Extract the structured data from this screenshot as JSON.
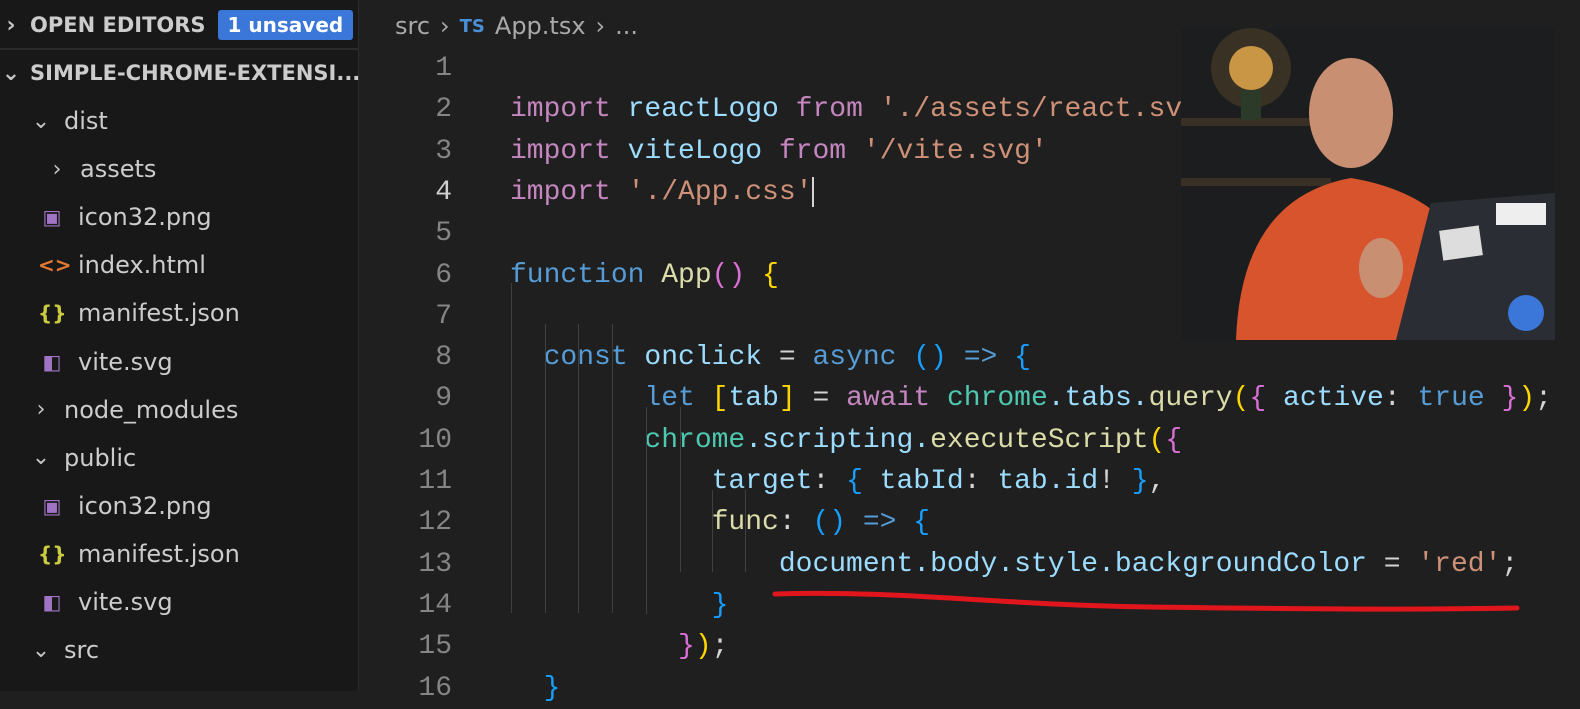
{
  "sidebar": {
    "open_editors": "OPEN EDITORS",
    "unsaved_badge": "1 unsaved",
    "project": "SIMPLE-CHROME-EXTENSI...",
    "items": [
      {
        "label": "dist",
        "icon": "chevron-down",
        "depth": 1
      },
      {
        "label": "assets",
        "icon": "chevron-right",
        "depth": 2
      },
      {
        "label": "icon32.png",
        "icon": "image",
        "depth": 2
      },
      {
        "label": "index.html",
        "icon": "html",
        "depth": 2
      },
      {
        "label": "manifest.json",
        "icon": "json",
        "depth": 2
      },
      {
        "label": "vite.svg",
        "icon": "svg",
        "depth": 2
      },
      {
        "label": "node_modules",
        "icon": "chevron-right",
        "depth": 1
      },
      {
        "label": "public",
        "icon": "chevron-down",
        "depth": 1
      },
      {
        "label": "icon32.png",
        "icon": "image",
        "depth": 2
      },
      {
        "label": "manifest.json",
        "icon": "json",
        "depth": 2
      },
      {
        "label": "vite.svg",
        "icon": "svg",
        "depth": 2
      },
      {
        "label": "src",
        "icon": "chevron-down",
        "depth": 1
      }
    ]
  },
  "breadcrumb": {
    "folder": "src",
    "lang": "TS",
    "file": "App.tsx",
    "more": "..."
  },
  "editor": {
    "current_line": 4,
    "lines": [
      {
        "n": "1",
        "tokens": []
      },
      {
        "n": "2",
        "tokens": [
          [
            "import",
            "kw"
          ],
          [
            " reactLogo ",
            "id"
          ],
          [
            "from",
            "kw"
          ],
          [
            " './assets/react.svg'",
            "st"
          ]
        ]
      },
      {
        "n": "3",
        "tokens": [
          [
            "import",
            "kw"
          ],
          [
            " viteLogo ",
            "id"
          ],
          [
            "from",
            "kw"
          ],
          [
            " '/vite.svg'",
            "st"
          ]
        ]
      },
      {
        "n": "4",
        "tokens": [
          [
            "import",
            "kw"
          ],
          [
            " './App.css'",
            "st"
          ]
        ],
        "cursor": true
      },
      {
        "n": "5",
        "tokens": []
      },
      {
        "n": "6",
        "tokens": [
          [
            "function",
            "bl"
          ],
          [
            " App",
            "fn"
          ],
          [
            "()",
            "b2"
          ],
          [
            " ",
            "pn"
          ],
          [
            "{",
            "b1"
          ]
        ]
      },
      {
        "n": "7",
        "tokens": []
      },
      {
        "n": "8",
        "tokens": [
          [
            "  const",
            "bl"
          ],
          [
            " onclick ",
            "id"
          ],
          [
            "= ",
            "pn"
          ],
          [
            "async",
            "bl"
          ],
          [
            " ",
            "pn"
          ],
          [
            "()",
            "b3"
          ],
          [
            " ",
            "pn"
          ],
          [
            "=>",
            "bl"
          ],
          [
            " ",
            "pn"
          ],
          [
            "{",
            "b3"
          ]
        ]
      },
      {
        "n": "9",
        "tokens": [
          [
            "        let",
            "bl"
          ],
          [
            " ",
            "pn"
          ],
          [
            "[",
            "b1"
          ],
          [
            "tab",
            "id"
          ],
          [
            "]",
            "b1"
          ],
          [
            " = ",
            "pn"
          ],
          [
            "await",
            "kw"
          ],
          [
            " chrome",
            "cl"
          ],
          [
            ".tabs.",
            "id"
          ],
          [
            "query",
            "fn"
          ],
          [
            "(",
            "b1"
          ],
          [
            "{",
            "b2"
          ],
          [
            " active",
            "id"
          ],
          [
            ": ",
            "pn"
          ],
          [
            "true",
            "bl"
          ],
          [
            " ",
            "pn"
          ],
          [
            "}",
            "b2"
          ],
          [
            ")",
            "b1"
          ],
          [
            ";",
            "pn"
          ]
        ]
      },
      {
        "n": "10",
        "tokens": [
          [
            "        chrome",
            "cl"
          ],
          [
            ".scripting.",
            "id"
          ],
          [
            "executeScript",
            "fn"
          ],
          [
            "(",
            "b1"
          ],
          [
            "{",
            "b2"
          ]
        ]
      },
      {
        "n": "11",
        "tokens": [
          [
            "            target",
            "id"
          ],
          [
            ": ",
            "pn"
          ],
          [
            "{",
            "b3"
          ],
          [
            " tabId",
            "id"
          ],
          [
            ": ",
            "pn"
          ],
          [
            "tab.id",
            "id"
          ],
          [
            "! ",
            "pn"
          ],
          [
            "}",
            "b3"
          ],
          [
            ",",
            "pn"
          ]
        ]
      },
      {
        "n": "12",
        "tokens": [
          [
            "            func",
            "fn"
          ],
          [
            ": ",
            "pn"
          ],
          [
            "()",
            "b3"
          ],
          [
            " ",
            "pn"
          ],
          [
            "=>",
            "bl"
          ],
          [
            " ",
            "pn"
          ],
          [
            "{",
            "b3"
          ]
        ]
      },
      {
        "n": "13",
        "tokens": [
          [
            "                document",
            "id"
          ],
          [
            ".body.style.backgroundColor",
            "id"
          ],
          [
            " = ",
            "pn"
          ],
          [
            "'red'",
            "st"
          ],
          [
            ";",
            "pn"
          ]
        ]
      },
      {
        "n": "14",
        "tokens": [
          [
            "            }",
            "b3"
          ]
        ]
      },
      {
        "n": "15",
        "tokens": [
          [
            "          }",
            "b2"
          ],
          [
            ")",
            "b1"
          ],
          [
            ";",
            "pn"
          ]
        ]
      },
      {
        "n": "16",
        "tokens": [
          [
            "  }",
            "b3"
          ]
        ]
      }
    ]
  },
  "colors": {
    "accent": "#3a77d9",
    "annotation": "#e0161c"
  }
}
